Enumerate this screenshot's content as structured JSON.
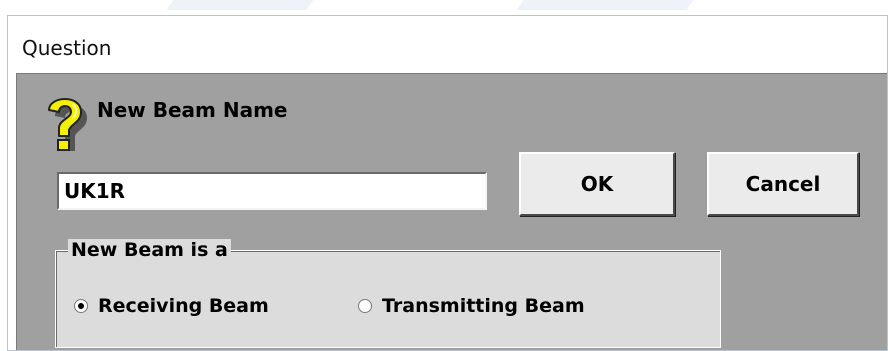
{
  "window": {
    "title": "Question"
  },
  "dialog": {
    "heading": "New Beam Name",
    "icon": "question-mark-icon",
    "name_input": {
      "value": "UK1R"
    },
    "ok_label": "OK",
    "cancel_label": "Cancel",
    "group": {
      "legend": "New Beam is a",
      "options": [
        {
          "label": "Receiving Beam",
          "checked": true
        },
        {
          "label": "Transmitting Beam",
          "checked": false
        }
      ]
    }
  },
  "colors": {
    "client_background": "#a0a0a0",
    "button_face": "#ebebeb",
    "icon_yellow": "#f5f000"
  }
}
